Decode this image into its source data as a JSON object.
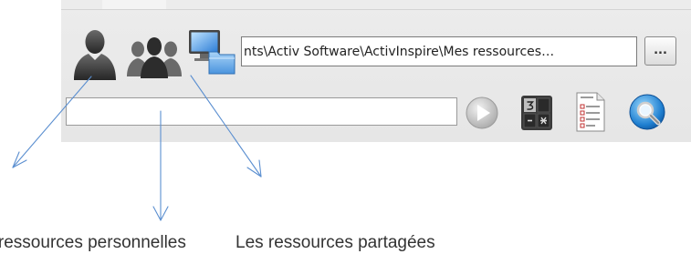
{
  "toolbar": {
    "path_value": "…nts\\Activ Software\\ActivInspire\\Mes ressources",
    "browse_label": "...",
    "search_value": ""
  },
  "icons": {
    "personal_resources": "single-user-icon",
    "shared_resources": "user-group-icon",
    "network_folder": "monitor-folder-icon",
    "go": "play-icon",
    "keypad": "calculator-icon",
    "document": "checklist-document-icon",
    "search": "magnifier-icon"
  },
  "captions": {
    "left": "Les ressources personnelles",
    "right": "Les ressources partagées"
  },
  "colors": {
    "annotation_arrow": "#5b8fd0",
    "panel_background": "#e8e8e8"
  }
}
